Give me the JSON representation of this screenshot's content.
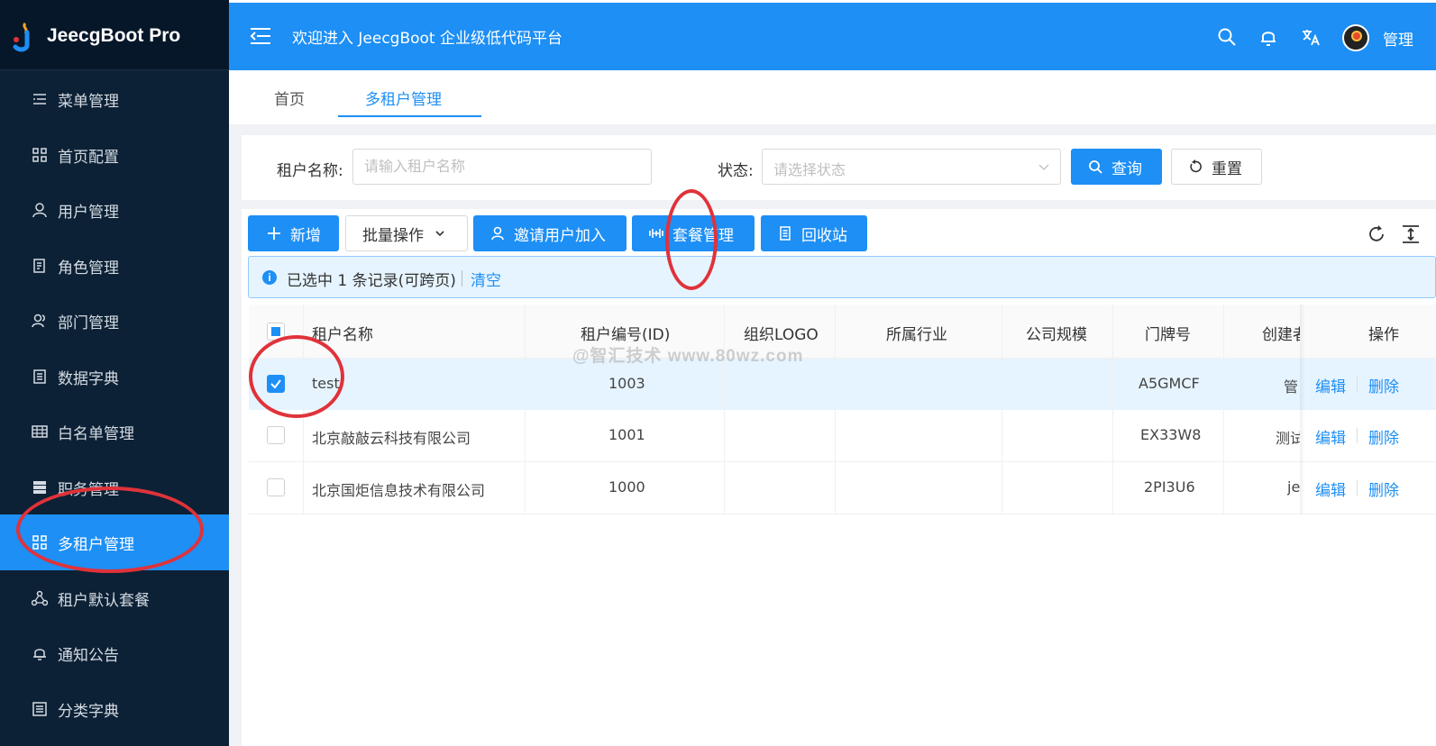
{
  "app": {
    "logo_text": "JeecgBoot Pro",
    "header_title": "欢迎进入 JeecgBoot 企业级低代码平台",
    "user_name": "管理",
    "accent_color": "#1d8ff5",
    "sidebar_color": "#0c2135"
  },
  "sidebar": {
    "items": [
      {
        "label": "菜单管理",
        "icon": "menu-list-icon"
      },
      {
        "label": "首页配置",
        "icon": "grid-icon"
      },
      {
        "label": "用户管理",
        "icon": "user-icon"
      },
      {
        "label": "角色管理",
        "icon": "role-icon"
      },
      {
        "label": "部门管理",
        "icon": "team-icon"
      },
      {
        "label": "数据字典",
        "icon": "book-icon"
      },
      {
        "label": "白名单管理",
        "icon": "table-icon"
      },
      {
        "label": "职务管理",
        "icon": "database-icon"
      },
      {
        "label": "多租户管理",
        "icon": "grid-icon",
        "active": true
      },
      {
        "label": "租户默认套餐",
        "icon": "cluster-icon"
      },
      {
        "label": "通知公告",
        "icon": "bell-icon"
      },
      {
        "label": "分类字典",
        "icon": "doc-icon"
      }
    ]
  },
  "tabs": [
    {
      "label": "首页"
    },
    {
      "label": "多租户管理",
      "active": true
    }
  ],
  "search": {
    "name_label": "租户名称:",
    "name_placeholder": "请输入租户名称",
    "status_label": "状态:",
    "status_placeholder": "请选择状态",
    "query_label": "查询",
    "reset_label": "重置"
  },
  "toolbar": {
    "add_label": "新增",
    "batch_label": "批量操作",
    "invite_label": "邀请用户加入",
    "package_label": "套餐管理",
    "recycle_label": "回收站"
  },
  "alert": {
    "text": "已选中 1 条记录(可跨页)",
    "clear_label": "清空"
  },
  "table": {
    "columns": [
      "租户名称",
      "租户编号(ID)",
      "组织LOGO",
      "所属行业",
      "公司规模",
      "门牌号",
      "创建者",
      "操作"
    ],
    "rows": [
      {
        "name": "test",
        "id": "1003",
        "house": "A5GMCF",
        "creator": "管",
        "selected": true
      },
      {
        "name": "北京敲敲云科技有限公司",
        "id": "1001",
        "house": "EX33W8",
        "creator": "测试",
        "selected": false
      },
      {
        "name": "北京国炬信息技术有限公司",
        "id": "1000",
        "house": "2PI3U6",
        "creator": "je",
        "selected": false
      }
    ],
    "edit_label": "编辑",
    "delete_label": "删除"
  },
  "watermark": "@智汇技术  www.80wz.com"
}
